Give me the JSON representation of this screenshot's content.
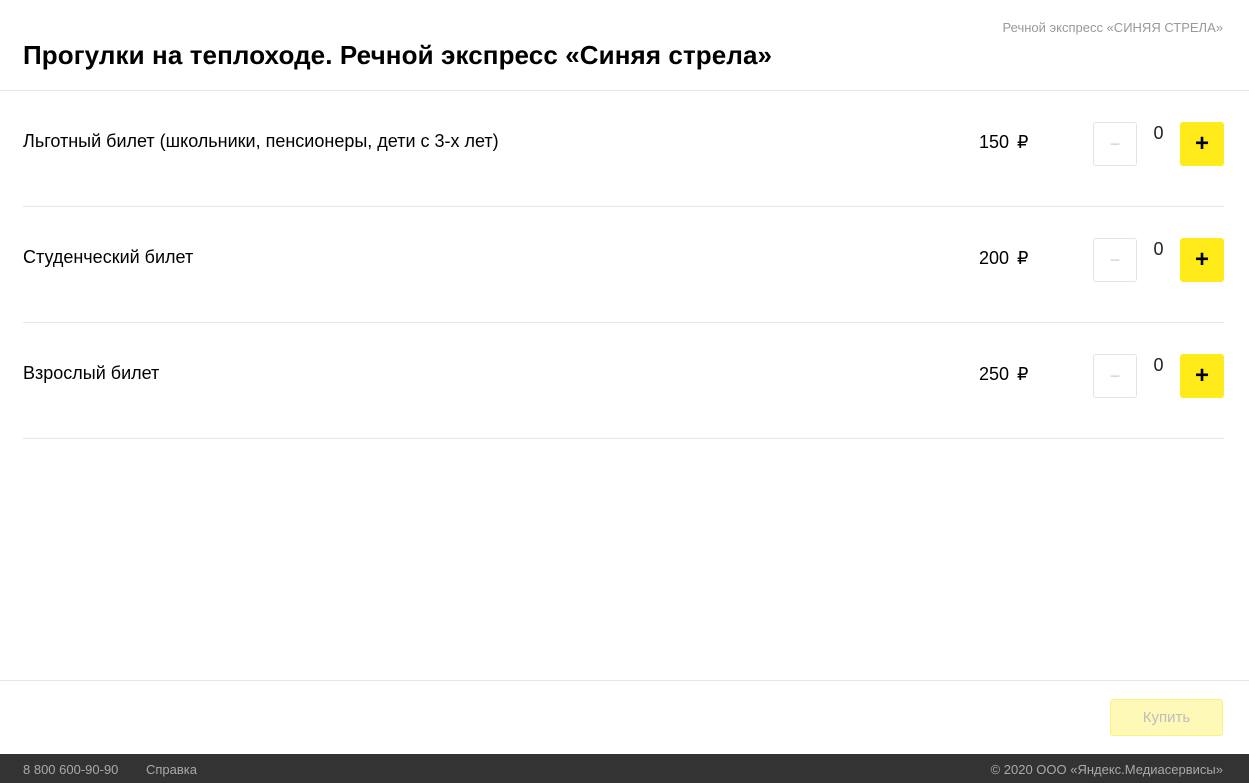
{
  "header": {
    "org_link": "Речной экспресс «СИНЯЯ СТРЕЛА»",
    "title": "Прогулки на теплоходе. Речной экспресс «Синяя стрела»"
  },
  "tickets": [
    {
      "name": "Льготный билет (школьники, пенсионеры, дети с 3-х лет)",
      "price": "150",
      "currency": "₽",
      "quantity": "0",
      "minus": "−",
      "plus": "+"
    },
    {
      "name": "Студенческий билет",
      "price": "200",
      "currency": "₽",
      "quantity": "0",
      "minus": "−",
      "plus": "+"
    },
    {
      "name": "Взрослый билет",
      "price": "250",
      "currency": "₽",
      "quantity": "0",
      "minus": "−",
      "plus": "+"
    }
  ],
  "buy_button_label": "Купить",
  "footer": {
    "phone": "8 800 600-90-90",
    "help": "Справка",
    "copyright": "© 2020 ООО «Яндекс.Медиасервисы»"
  },
  "colors": {
    "accent": "#ffeb1a",
    "footer_bg": "#333333"
  }
}
